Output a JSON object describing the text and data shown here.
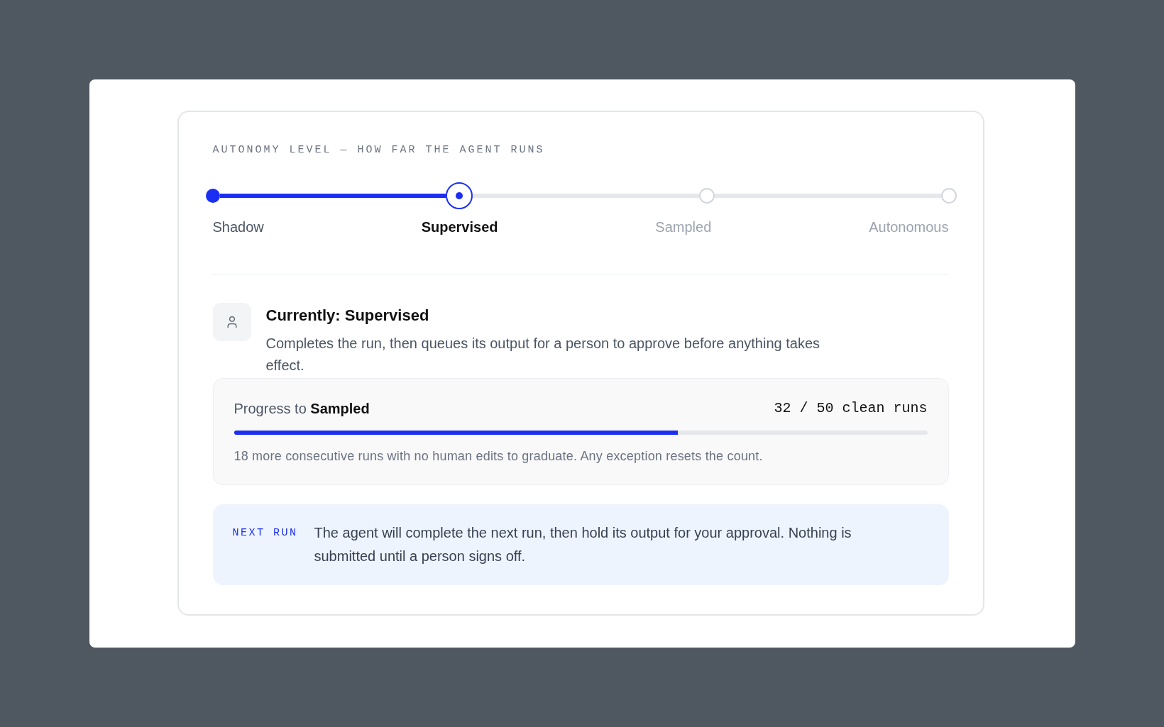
{
  "autonomy": {
    "heading": "AUTONOMY LEVEL — HOW FAR THE AGENT RUNS",
    "steps": [
      {
        "label": "Shadow",
        "selected": false
      },
      {
        "label": "Supervised",
        "selected": true
      },
      {
        "label": "Sampled",
        "selected": false
      },
      {
        "label": "Autonomous",
        "selected": false
      }
    ]
  },
  "current": {
    "title": "Currently: Supervised",
    "description": "Completes the run, then queues its output for a person to approve before anything takes effect."
  },
  "progress": {
    "label": "Progress to **Sampled**",
    "count": "32 / 50 clean runs",
    "level": 0.64,
    "note": "18 more consecutive runs with no human edits to graduate. Any exception resets the count."
  },
  "next_run": {
    "tag": "NEXT RUN",
    "text": "The agent will complete the next run, then hold its output for your approval. Nothing is submitted until a person signs off."
  }
}
